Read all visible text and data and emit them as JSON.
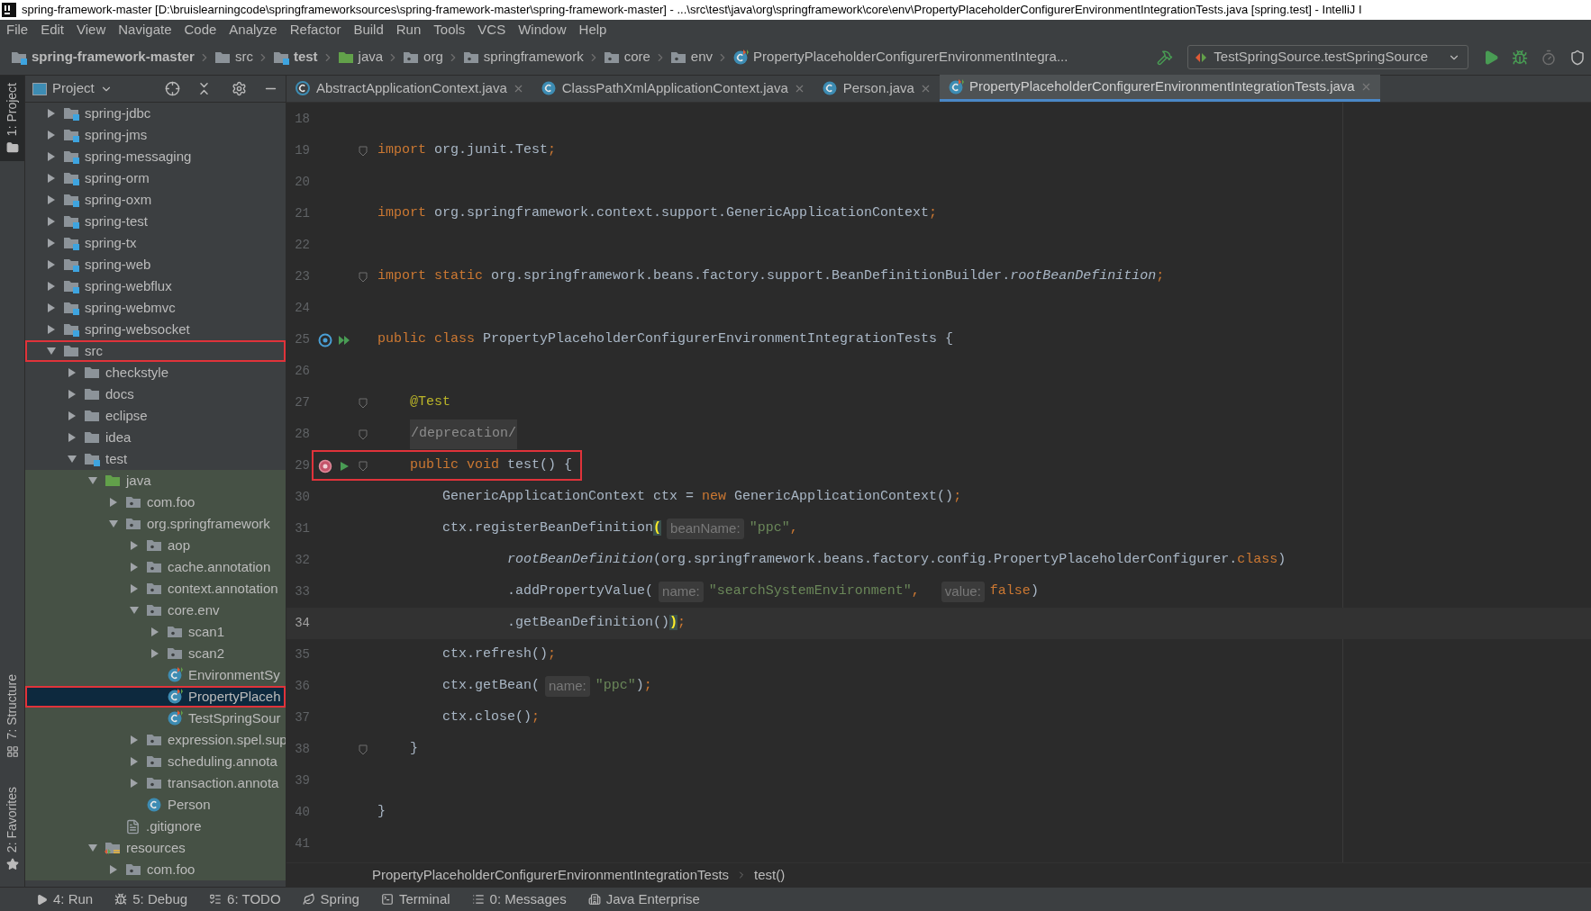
{
  "window": {
    "title": "spring-framework-master [D:\\bruislearningcode\\springframeworksources\\spring-framework-master\\spring-framework-master] - ...\\src\\test\\java\\org\\springframework\\core\\env\\PropertyPlaceholderConfigurerEnvironmentIntegrationTests.java [spring.test] - IntelliJ I"
  },
  "menu": [
    "File",
    "Edit",
    "View",
    "Navigate",
    "Code",
    "Analyze",
    "Refactor",
    "Build",
    "Run",
    "Tools",
    "VCS",
    "Window",
    "Help"
  ],
  "navigation": [
    {
      "label": "spring-framework-master",
      "kind": "module",
      "bold": true
    },
    {
      "label": "src",
      "kind": "folder",
      "bold": false
    },
    {
      "label": "test",
      "kind": "module",
      "bold": true
    },
    {
      "label": "java",
      "kind": "source",
      "bold": false
    },
    {
      "label": "org",
      "kind": "package",
      "bold": false
    },
    {
      "label": "springframework",
      "kind": "package",
      "bold": false
    },
    {
      "label": "core",
      "kind": "package",
      "bold": false
    },
    {
      "label": "env",
      "kind": "package",
      "bold": false
    },
    {
      "label": "PropertyPlaceholderConfigurerEnvironmentIntegra...",
      "kind": "test-class",
      "bold": false
    }
  ],
  "run_configuration": {
    "label": "TestSpringSource.testSpringSource"
  },
  "tool_stripe": [
    {
      "label": "1: Project",
      "kind": "folder",
      "selected": true
    },
    {
      "label": "7: Structure",
      "kind": "structure",
      "selected": false
    },
    {
      "label": "2: Favorites",
      "kind": "star",
      "selected": false
    }
  ],
  "project_panel": {
    "title": "Project",
    "tree": [
      {
        "label": "spring-jdbc",
        "kind": "module",
        "expanded": false,
        "selected": false,
        "marked": false
      },
      {
        "label": "spring-jms",
        "kind": "module",
        "expanded": false,
        "selected": false,
        "marked": false
      },
      {
        "label": "spring-messaging",
        "kind": "module",
        "expanded": false,
        "selected": false,
        "marked": false
      },
      {
        "label": "spring-orm",
        "kind": "module",
        "expanded": false,
        "selected": false,
        "marked": false
      },
      {
        "label": "spring-oxm",
        "kind": "module",
        "expanded": false,
        "selected": false,
        "marked": false
      },
      {
        "label": "spring-test",
        "kind": "module",
        "expanded": false,
        "selected": false,
        "marked": false
      },
      {
        "label": "spring-tx",
        "kind": "module",
        "expanded": false,
        "selected": false,
        "marked": false
      },
      {
        "label": "spring-web",
        "kind": "module",
        "expanded": false,
        "selected": false,
        "marked": false
      },
      {
        "label": "spring-webflux",
        "kind": "module",
        "expanded": false,
        "selected": false,
        "marked": false
      },
      {
        "label": "spring-webmvc",
        "kind": "module",
        "expanded": false,
        "selected": false,
        "marked": false
      },
      {
        "label": "spring-websocket",
        "kind": "module",
        "expanded": false,
        "selected": false,
        "marked": false
      },
      {
        "label": "src",
        "kind": "folder",
        "expanded": true,
        "selected": false,
        "marked": true,
        "children": [
          {
            "label": "checkstyle",
            "kind": "folder",
            "expanded": false,
            "selected": false,
            "marked": false
          },
          {
            "label": "docs",
            "kind": "folder",
            "expanded": false,
            "selected": false,
            "marked": false
          },
          {
            "label": "eclipse",
            "kind": "folder",
            "expanded": false,
            "selected": false,
            "marked": false
          },
          {
            "label": "idea",
            "kind": "folder",
            "expanded": false,
            "selected": false,
            "marked": false
          },
          {
            "label": "test",
            "kind": "module",
            "expanded": true,
            "selected": false,
            "marked": false,
            "children": [
              {
                "label": "java",
                "kind": "source",
                "expanded": true,
                "selected": false,
                "marked": false,
                "shaded": true,
                "children": [
                  {
                    "label": "com.foo",
                    "kind": "package",
                    "expanded": false,
                    "selected": false,
                    "marked": false
                  },
                  {
                    "label": "org.springframework",
                    "kind": "package",
                    "expanded": true,
                    "selected": false,
                    "marked": false,
                    "children": [
                      {
                        "label": "aop",
                        "kind": "package",
                        "expanded": false,
                        "selected": false,
                        "marked": false
                      },
                      {
                        "label": "cache.annotation",
                        "kind": "package",
                        "expanded": false,
                        "selected": false,
                        "marked": false
                      },
                      {
                        "label": "context.annotation",
                        "kind": "package",
                        "expanded": false,
                        "selected": false,
                        "marked": false
                      },
                      {
                        "label": "core.env",
                        "kind": "package",
                        "expanded": true,
                        "selected": false,
                        "marked": false,
                        "children": [
                          {
                            "label": "scan1",
                            "kind": "package",
                            "expanded": false,
                            "selected": false,
                            "marked": false
                          },
                          {
                            "label": "scan2",
                            "kind": "package",
                            "expanded": false,
                            "selected": false,
                            "marked": false
                          },
                          {
                            "label": "EnvironmentSy",
                            "kind": "test-class",
                            "selected": false,
                            "marked": false
                          },
                          {
                            "label": "PropertyPlaceh",
                            "kind": "test-class",
                            "selected": true,
                            "marked": true
                          },
                          {
                            "label": "TestSpringSour",
                            "kind": "test-class",
                            "selected": false,
                            "marked": false
                          }
                        ]
                      },
                      {
                        "label": "expression.spel.sup",
                        "kind": "package",
                        "expanded": false,
                        "selected": false,
                        "marked": false
                      },
                      {
                        "label": "scheduling.annota",
                        "kind": "package",
                        "expanded": false,
                        "selected": false,
                        "marked": false
                      },
                      {
                        "label": "transaction.annota",
                        "kind": "package",
                        "expanded": false,
                        "selected": false,
                        "marked": false
                      },
                      {
                        "label": "Person",
                        "kind": "class",
                        "selected": false,
                        "marked": false
                      }
                    ]
                  },
                  {
                    "label": ".gitignore",
                    "kind": "file",
                    "selected": false,
                    "marked": false
                  }
                ]
              },
              {
                "label": "resources",
                "kind": "resources",
                "expanded": true,
                "selected": false,
                "marked": false,
                "shaded": true,
                "children": [
                  {
                    "label": "com.foo",
                    "kind": "package",
                    "expanded": false,
                    "selected": false,
                    "marked": false
                  }
                ]
              }
            ]
          }
        ]
      }
    ]
  },
  "tabs": [
    {
      "label": "AbstractApplicationContext.java",
      "kind": "abstract-class",
      "selected": false
    },
    {
      "label": "ClassPathXmlApplicationContext.java",
      "kind": "class",
      "selected": false
    },
    {
      "label": "Person.java",
      "kind": "class",
      "selected": false
    },
    {
      "label": "PropertyPlaceholderConfigurerEnvironmentIntegrationTests.java",
      "kind": "test-class",
      "selected": true
    }
  ],
  "editor": {
    "lines": [
      {
        "number": "18",
        "current": false,
        "marked": false
      },
      {
        "number": "19",
        "gutter": [
          {
            "kind": "fold"
          }
        ],
        "current": false,
        "marked": false,
        "tokens": [
          {
            "text": "import",
            "kind": "keyword"
          },
          {
            "text": " org.junit.Test",
            "kind": "plain"
          },
          {
            "text": ";",
            "kind": "punct"
          }
        ]
      },
      {
        "number": "20",
        "current": false,
        "marked": false
      },
      {
        "number": "21",
        "current": false,
        "marked": false,
        "tokens": [
          {
            "text": "import",
            "kind": "keyword"
          },
          {
            "text": " org.springframework.context.support.GenericApplicationContext",
            "kind": "plain"
          },
          {
            "text": ";",
            "kind": "punct"
          }
        ]
      },
      {
        "number": "22",
        "current": false,
        "marked": false
      },
      {
        "number": "23",
        "gutter": [
          {
            "kind": "fold"
          }
        ],
        "current": false,
        "marked": false,
        "tokens": [
          {
            "text": "import static",
            "kind": "keyword"
          },
          {
            "text": " org.springframework.beans.factory.support.BeanDefinitionBuilder.",
            "kind": "plain"
          },
          {
            "text": "rootBeanDefinition",
            "kind": "italic"
          },
          {
            "text": ";",
            "kind": "punct"
          }
        ]
      },
      {
        "number": "24",
        "current": false,
        "marked": false
      },
      {
        "number": "25",
        "gutter": [
          {
            "kind": "bean"
          },
          {
            "kind": "run-all"
          }
        ],
        "current": false,
        "marked": false,
        "tokens": [
          {
            "text": "public class",
            "kind": "keyword"
          },
          {
            "text": " PropertyPlaceholderConfigurerEnvironmentIntegrationTests {",
            "kind": "plain"
          }
        ]
      },
      {
        "number": "26",
        "current": false,
        "marked": false
      },
      {
        "number": "27",
        "gutter": [
          {
            "kind": "fold"
          }
        ],
        "current": false,
        "marked": false,
        "tokens": [
          {
            "text": "    @Test",
            "kind": "annotation"
          }
        ]
      },
      {
        "number": "28",
        "gutter": [
          {
            "kind": "fold"
          }
        ],
        "current": false,
        "marked": false,
        "tokens": [
          {
            "text": "    /deprecation/",
            "kind": "folded"
          }
        ]
      },
      {
        "number": "29",
        "gutter": [
          {
            "kind": "bean-error"
          },
          {
            "kind": "run"
          },
          {
            "kind": "fold"
          }
        ],
        "current": false,
        "marked": true,
        "tokens": [
          {
            "text": "    public void",
            "kind": "keyword"
          },
          {
            "text": " test() {",
            "kind": "plain"
          }
        ]
      },
      {
        "number": "30",
        "current": false,
        "marked": false,
        "tokens": [
          {
            "text": "        GenericApplicationContext ctx = ",
            "kind": "plain"
          },
          {
            "text": "new",
            "kind": "keyword"
          },
          {
            "text": " GenericApplicationContext()",
            "kind": "plain"
          },
          {
            "text": ";",
            "kind": "punct"
          }
        ]
      },
      {
        "number": "31",
        "current": false,
        "marked": false,
        "tokens": [
          {
            "text": "        ctx.registerBeanDefinition",
            "kind": "plain"
          },
          {
            "text": "(",
            "kind": "match"
          },
          {
            "text": "beanName:",
            "kind": "hint"
          },
          {
            "text": "\"ppc\"",
            "kind": "string"
          },
          {
            "text": ",",
            "kind": "punct"
          }
        ]
      },
      {
        "number": "32",
        "current": false,
        "marked": false,
        "tokens": [
          {
            "text": "                rootBeanDefinition",
            "kind": "italic"
          },
          {
            "text": "(org.springframework.beans.factory.config.PropertyPlaceholderConfigurer.",
            "kind": "plain"
          },
          {
            "text": "class",
            "kind": "keyword"
          },
          {
            "text": ")",
            "kind": "plain"
          }
        ]
      },
      {
        "number": "33",
        "current": false,
        "marked": false,
        "tokens": [
          {
            "text": "                .addPropertyValue(",
            "kind": "plain"
          },
          {
            "text": "name:",
            "kind": "hint"
          },
          {
            "text": "\"searchSystemEnvironment\"",
            "kind": "string"
          },
          {
            "text": ", ",
            "kind": "punct"
          },
          {
            "text": "value:",
            "kind": "hint"
          },
          {
            "text": "false",
            "kind": "keyword"
          },
          {
            "text": ")",
            "kind": "plain"
          }
        ]
      },
      {
        "number": "34",
        "current": true,
        "marked": false,
        "tokens": [
          {
            "text": "                .getBeanDefinition()",
            "kind": "plain"
          },
          {
            "text": ")",
            "kind": "match"
          },
          {
            "text": ";",
            "kind": "punct"
          }
        ]
      },
      {
        "number": "35",
        "current": false,
        "marked": false,
        "tokens": [
          {
            "text": "        ctx.refresh()",
            "kind": "plain"
          },
          {
            "text": ";",
            "kind": "punct"
          }
        ]
      },
      {
        "number": "36",
        "current": false,
        "marked": false,
        "tokens": [
          {
            "text": "        ctx.getBean(",
            "kind": "plain"
          },
          {
            "text": "name:",
            "kind": "hint"
          },
          {
            "text": "\"ppc\"",
            "kind": "string"
          },
          {
            "text": ")",
            "kind": "plain"
          },
          {
            "text": ";",
            "kind": "punct"
          }
        ]
      },
      {
        "number": "37",
        "current": false,
        "marked": false,
        "tokens": [
          {
            "text": "        ctx.close()",
            "kind": "plain"
          },
          {
            "text": ";",
            "kind": "punct"
          }
        ]
      },
      {
        "number": "38",
        "gutter": [
          {
            "kind": "fold"
          }
        ],
        "current": false,
        "marked": false,
        "tokens": [
          {
            "text": "    }",
            "kind": "plain"
          }
        ]
      },
      {
        "number": "39",
        "current": false,
        "marked": false
      },
      {
        "number": "40",
        "current": false,
        "marked": false,
        "tokens": [
          {
            "text": "}",
            "kind": "plain"
          }
        ]
      },
      {
        "number": "41",
        "current": false,
        "marked": false
      }
    ],
    "breadcrumbs": [
      "PropertyPlaceholderConfigurerEnvironmentIntegrationTests",
      "test()"
    ]
  },
  "tool_windows": [
    {
      "label": "4: Run",
      "kind": "run"
    },
    {
      "label": "5: Debug",
      "kind": "debug"
    },
    {
      "label": "6: TODO",
      "kind": "todo"
    },
    {
      "label": "Spring",
      "kind": "spring"
    },
    {
      "label": "Terminal",
      "kind": "terminal"
    },
    {
      "label": "0: Messages",
      "kind": "messages"
    },
    {
      "label": "Java Enterprise",
      "kind": "enterprise"
    }
  ]
}
